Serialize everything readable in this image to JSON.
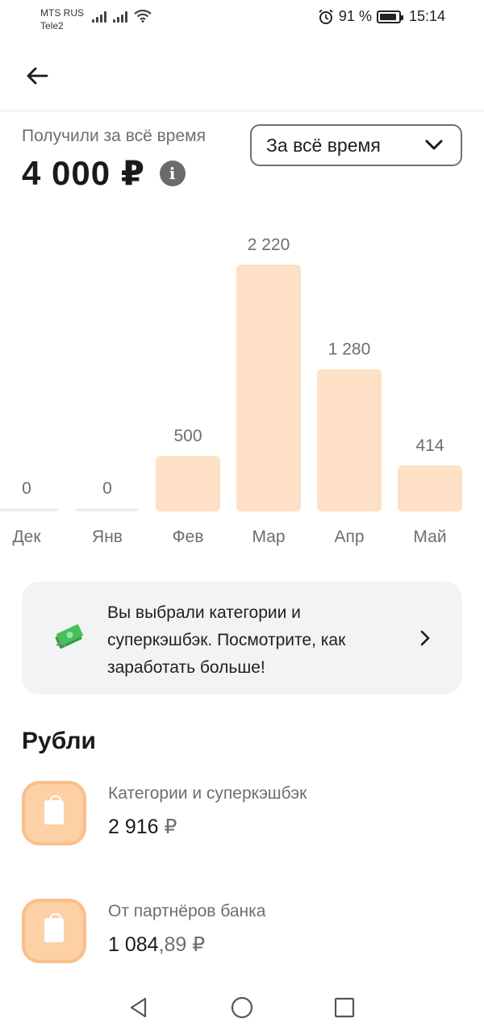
{
  "status_bar": {
    "carrier_1": "MTS RUS",
    "carrier_2": "Tele2",
    "battery_percent": "91 %",
    "battery_level": 0.91,
    "time": "15:14"
  },
  "summary": {
    "label": "Получили за всё время",
    "total": "4 000 ₽",
    "info_icon": "info-icon"
  },
  "period_select": {
    "value": "За всё время",
    "icon": "chevron-down-icon"
  },
  "chart_data": {
    "type": "bar",
    "categories": [
      "Дек",
      "Янв",
      "Фев",
      "Мар",
      "Апр",
      "Май"
    ],
    "values": [
      0,
      0,
      500,
      2220,
      1280,
      414
    ],
    "value_labels": [
      "0",
      "0",
      "500",
      "2 220",
      "1 280",
      "414"
    ],
    "ylim": [
      0,
      2220
    ],
    "bar_color": "#fde0c6",
    "grid": false
  },
  "promo": {
    "text": "Вы выбрали категории и суперкэшбэк. Посмотрите, как заработать больше!",
    "icon": "money-stack-icon",
    "chevron": "chevron-right-icon"
  },
  "section": {
    "title": "Рубли"
  },
  "entries": [
    {
      "label": "Категории и суперкэшбэк",
      "value_int": "2 916",
      "value_frac": "",
      "currency": " ₽",
      "icon": "shopping-bag-icon"
    },
    {
      "label": "От партнёров банка",
      "value_int": "1 084",
      "value_frac": ",89",
      "currency": " ₽",
      "icon": "shopping-bag-icon"
    }
  ],
  "colors": {
    "accent_icon_bg": "#fdd0a6",
    "bar": "#fde0c6",
    "promo_bg": "#f2f3f5"
  }
}
